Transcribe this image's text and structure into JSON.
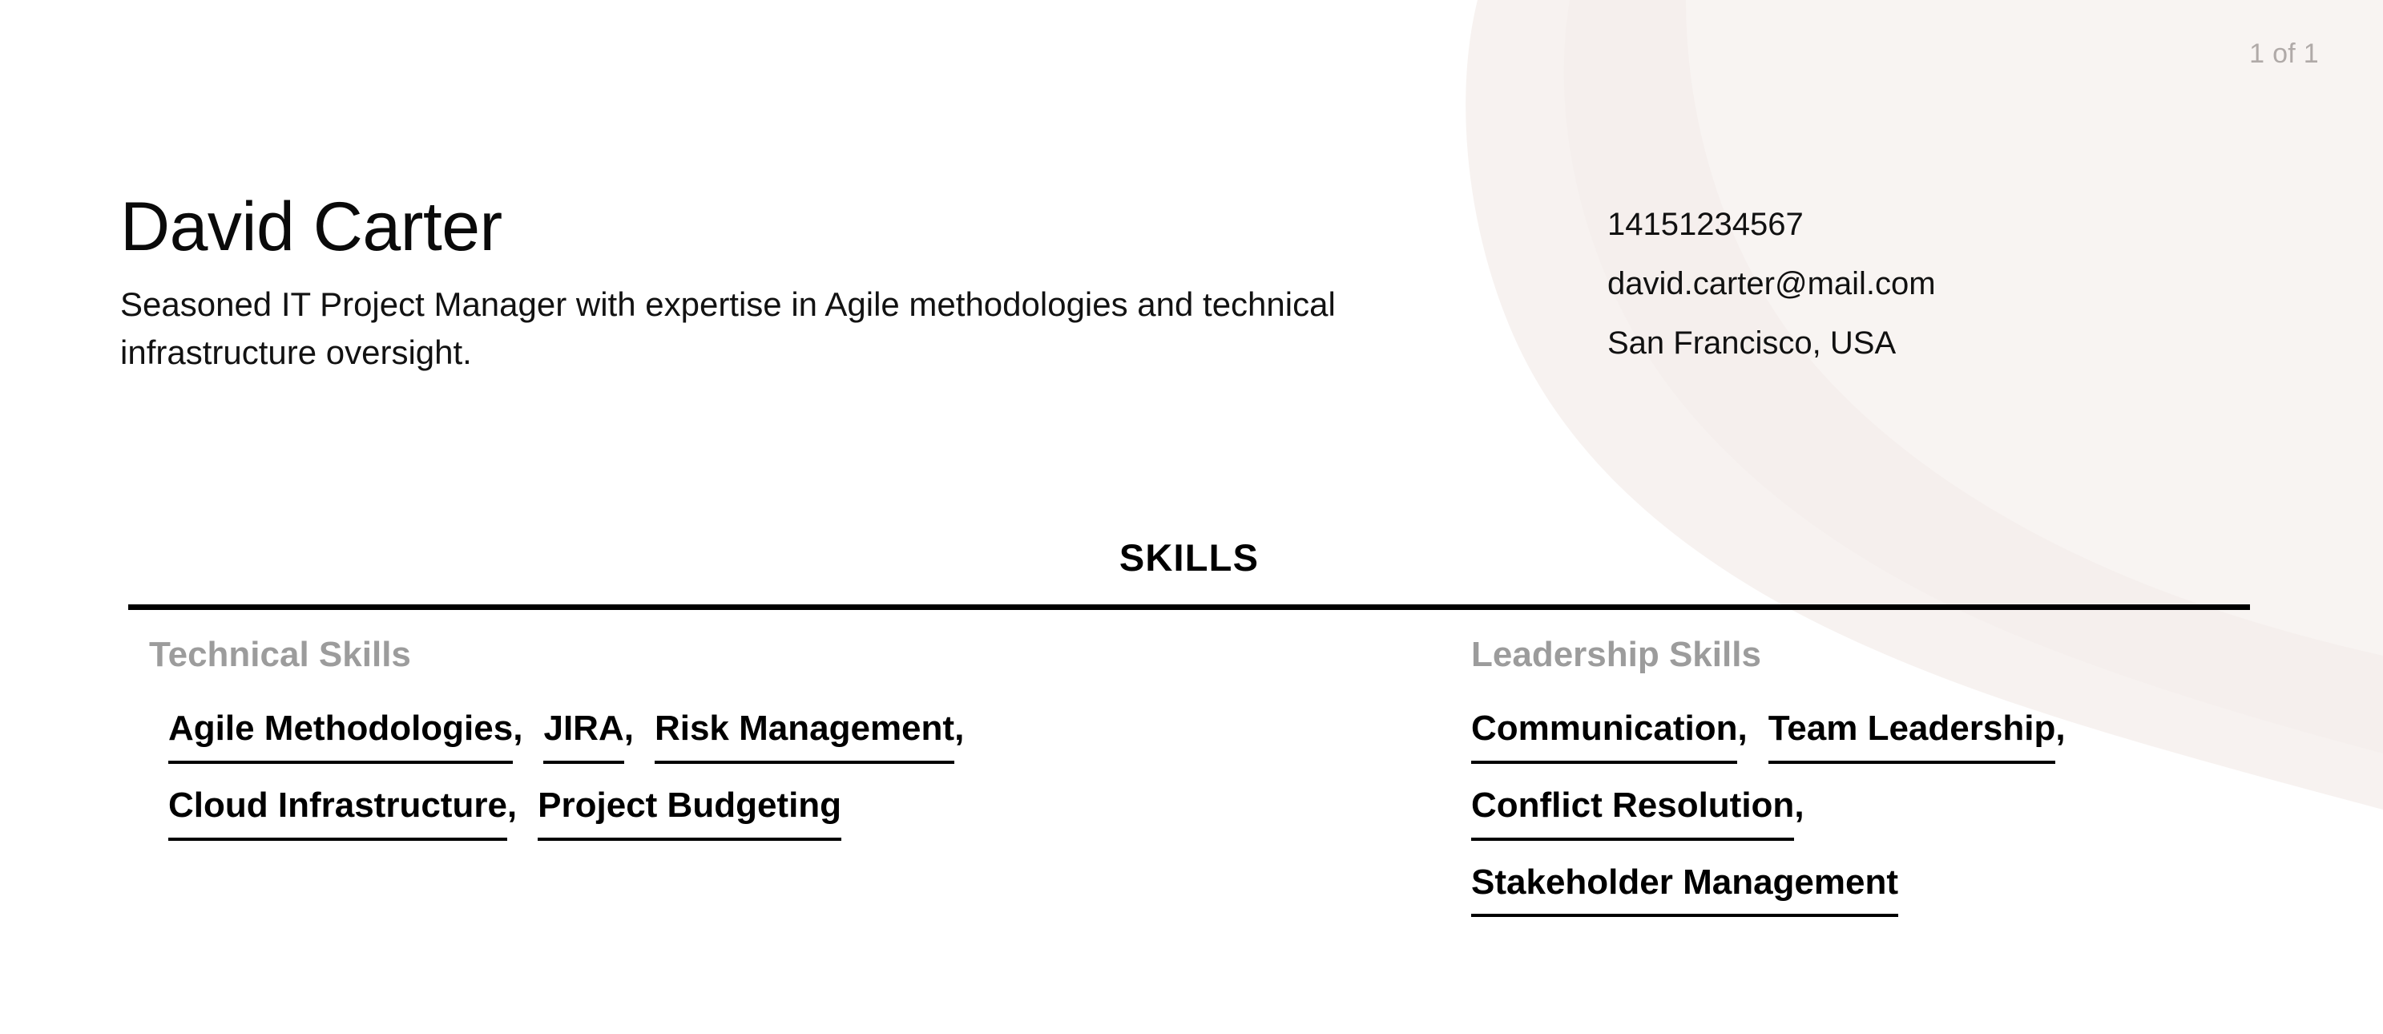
{
  "page_indicator": "1 of 1",
  "colors": {
    "text": "#0a0a0a",
    "muted_label": "#9c9c9c",
    "page_indicator": "#b0aaa8",
    "decor_blob": "#f7f2f0",
    "rule": "#000000",
    "background": "#ffffff"
  },
  "header": {
    "full_name": "David Carter",
    "tagline": "Seasoned IT Project Manager with expertise in Agile methodologies and technical infrastructure oversight.",
    "contact": {
      "phone": "14151234567",
      "email": "david.carter@mail.com",
      "location": "San Francisco, USA"
    }
  },
  "sections": [
    {
      "title": "SKILLS",
      "groups": [
        {
          "label": "Technical Skills",
          "skills": [
            "Agile Methodologies",
            "JIRA",
            "Risk Management",
            "Cloud Infrastructure",
            "Project Budgeting"
          ]
        },
        {
          "label": "Leadership Skills",
          "skills": [
            "Communication",
            "Team Leadership",
            "Conflict Resolution",
            "Stakeholder Management"
          ]
        }
      ]
    }
  ],
  "separator": ","
}
